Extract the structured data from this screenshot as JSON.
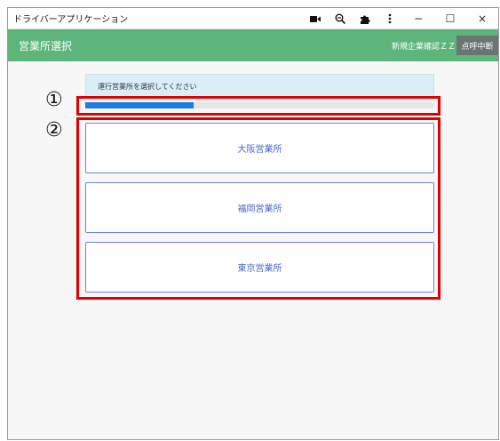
{
  "window": {
    "title": "ドライバーアプリケーション"
  },
  "titlebar_icons": [
    "camera-icon",
    "zoom-out-icon",
    "puzzle-icon",
    "more-vert-icon"
  ],
  "window_controls": {
    "minimize": "−",
    "maximize": "☐",
    "close": "×"
  },
  "appbar": {
    "title": "営業所選択",
    "user_label": "新規企業確認ＺＺ",
    "interrupt_label": "点呼中断"
  },
  "info": {
    "message": "運行営業所を選択してください"
  },
  "progress": {
    "percent": 31
  },
  "annotations": {
    "one": "①",
    "two": "②"
  },
  "offices": [
    "大阪営業所",
    "福岡営業所",
    "東京営業所"
  ],
  "colors": {
    "accent_green": "#5db57c",
    "progress_blue": "#1e7be0",
    "annotation_red": "#e00000",
    "button_text": "#4a67c9"
  }
}
